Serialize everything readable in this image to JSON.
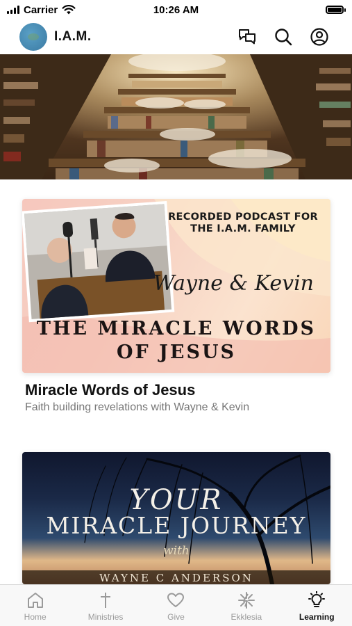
{
  "status_bar": {
    "carrier": "Carrier",
    "time": "10:26 AM"
  },
  "header": {
    "brand_name": "I.A.M.",
    "actions": [
      "chat-icon",
      "search-icon",
      "profile-icon"
    ]
  },
  "colors": {
    "brand_logo": "#4a8fb8",
    "tab_active": "#111111",
    "tab_inactive": "#9a9a9a",
    "subtitle": "#777777"
  },
  "content": {
    "cards": [
      {
        "image": {
          "heading": "RECORDED PODCAST FOR THE I.A.M. FAMILY",
          "names": "Wayne & Kevin",
          "title_line1": "THE MIRACLE WORDS",
          "title_line2": "OF JESUS"
        },
        "title": "Miracle Words of Jesus",
        "subtitle": "Faith building revelations with Wayne & Kevin"
      },
      {
        "image": {
          "title_line1": "YOUR",
          "title_line2": "MIRACLE JOURNEY",
          "with": "with",
          "author": "WAYNE C ANDERSON"
        }
      }
    ]
  },
  "tabs": [
    {
      "label": "Home",
      "icon": "home-icon",
      "active": false
    },
    {
      "label": "Ministries",
      "icon": "cross-icon",
      "active": false
    },
    {
      "label": "Give",
      "icon": "heart-icon",
      "active": false
    },
    {
      "label": "Ekklesia",
      "icon": "spark-icon",
      "active": false
    },
    {
      "label": "Learning",
      "icon": "lightbulb-icon",
      "active": true
    }
  ]
}
